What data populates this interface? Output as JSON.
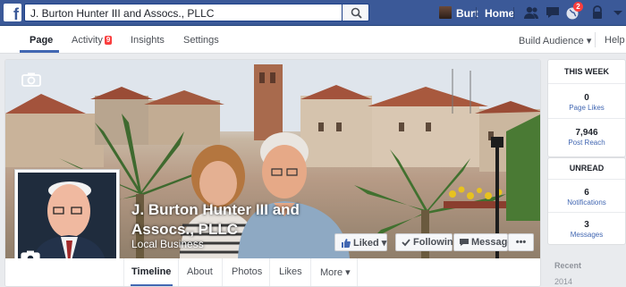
{
  "topbar": {
    "logo": "f",
    "search_value": "J. Burton Hunter III and Assocs., PLLC",
    "user_name": "Burt",
    "home_label": "Home",
    "notification_count": "2"
  },
  "page_nav": {
    "tabs": [
      {
        "label": "Page"
      },
      {
        "label": "Activity",
        "badge": "9"
      },
      {
        "label": "Insights"
      },
      {
        "label": "Settings"
      }
    ],
    "build_audience": "Build Audience ▾",
    "help": "Help"
  },
  "page": {
    "name": "J. Burton Hunter III and Assocs., PLLC",
    "category": "Local Business"
  },
  "actions": {
    "liked": "Liked ▾",
    "following": "Following",
    "message": "Message",
    "more": "•••"
  },
  "tabs": [
    {
      "label": "Timeline"
    },
    {
      "label": "About"
    },
    {
      "label": "Photos"
    },
    {
      "label": "Likes"
    },
    {
      "label": "More ▾"
    }
  ],
  "sidebar": {
    "this_week_title": "THIS WEEK",
    "stats": [
      {
        "value": "0",
        "label": "Page Likes"
      },
      {
        "value": "7,946",
        "label": "Post Reach"
      }
    ],
    "unread_title": "UNREAD",
    "unread": [
      {
        "value": "6",
        "label": "Notifications"
      },
      {
        "value": "3",
        "label": "Messages"
      }
    ],
    "recent_title": "Recent",
    "years": [
      "2014"
    ]
  },
  "colors": {
    "brand_blue": "#3b5998",
    "link_blue": "#4267b2",
    "alert_red": "#fa3e3e"
  }
}
